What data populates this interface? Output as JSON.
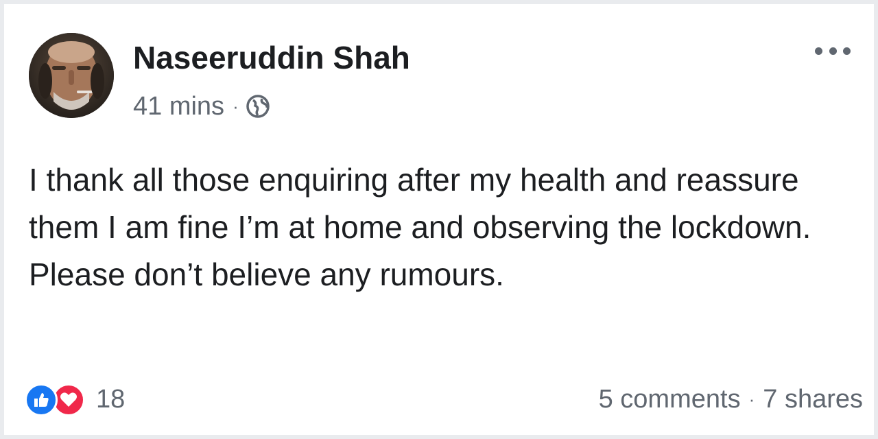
{
  "post": {
    "author": "Naseeruddin Shah",
    "timestamp": "41 mins",
    "separator": "·",
    "privacy_icon": "globe-icon",
    "more_icon": "more-options-icon",
    "text": "I thank all those enquiring after my health and reassure them I am fine I’m at home and observing the lockdown. Please don’t believe any rumours."
  },
  "reactions": {
    "icons": [
      "like-reaction-icon",
      "love-reaction-icon"
    ],
    "count": "18"
  },
  "stats": {
    "comments": "5 comments",
    "separator": "·",
    "shares": "7 shares"
  },
  "colors": {
    "like": "#1877f2",
    "love": "#f0284a",
    "secondary_text": "#606770",
    "primary_text": "#1c1e21"
  }
}
